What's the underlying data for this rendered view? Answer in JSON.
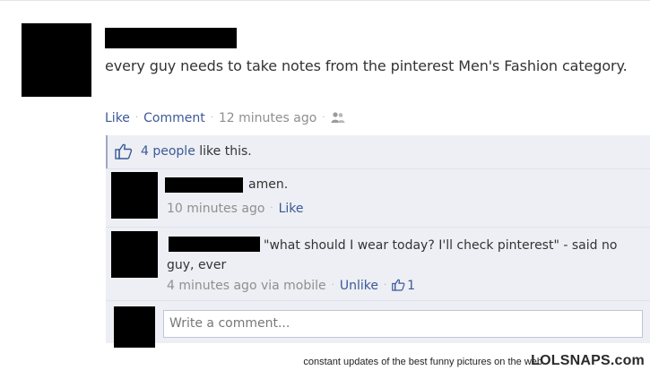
{
  "post": {
    "text": "every guy needs to take notes from the pinterest Men's Fashion category.",
    "like_link": "Like",
    "comment_link": "Comment",
    "timestamp": "12 minutes ago",
    "audience_icon": "friends-icon"
  },
  "likes": {
    "icon": "thumbs-up-icon",
    "people_link": "4 people",
    "suffix": "like this."
  },
  "comments": [
    {
      "text": "amen.",
      "timestamp": "10 minutes ago",
      "action_link": "Like"
    },
    {
      "text": "\"what should I wear today? I'll check pinterest\" - said no guy, ever",
      "timestamp": "4 minutes ago via mobile",
      "action_link": "Unlike",
      "like_count": "1",
      "like_icon": "thumbs-up-icon"
    }
  ],
  "write_comment": {
    "placeholder": "Write a comment..."
  },
  "footer": {
    "caption": "constant updates of the best funny pictures on the web",
    "logo": "LOLSNAPS.com"
  },
  "colors": {
    "link": "#3b5998",
    "panel": "#edeff4",
    "meta": "#8f8f8f"
  }
}
